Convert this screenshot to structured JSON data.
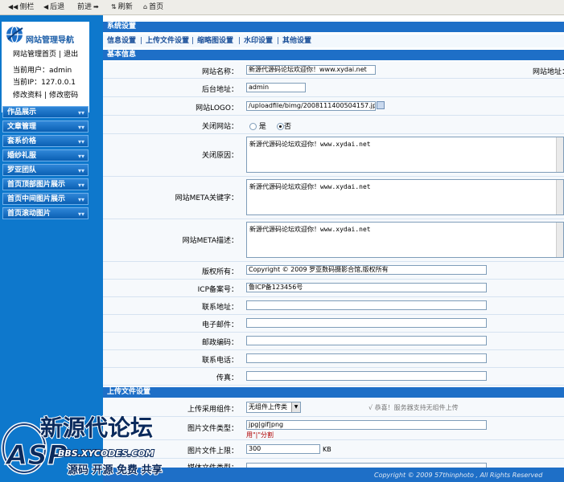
{
  "toolbar": {
    "sidebar_label": "侧栏",
    "back_label": "后退",
    "forward_label": "前进",
    "refresh_label": "刷新",
    "home_label": "首页"
  },
  "sidebar": {
    "logo_title": "网站管理导航",
    "link_home": "网站管理首页",
    "link_logout": "退出",
    "current_user_label": "当前用户：",
    "current_user": "admin",
    "current_ip_label": "当前IP：",
    "current_ip": "127.0.0.1",
    "link_edit_profile": "修改资料",
    "link_change_password": "修改密码",
    "menu": [
      "作品展示",
      "文章管理",
      "套系价格",
      "婚纱礼服",
      "罗亚团队",
      "首页顶部图片展示",
      "首页中间图片展示",
      "首页滚动图片"
    ]
  },
  "main": {
    "section_title": "系统设置",
    "tabs": [
      "信息设置",
      "上传文件设置",
      "缩略图设置",
      "水印设置",
      "其他设置"
    ],
    "basic_header": "基本信息",
    "site_name_label": "网站名称：",
    "site_name": "新源代源码论坛欢迎你！www.xydai.net",
    "site_url_label": "网站地址：",
    "admin_url_label": "后台地址：",
    "admin_url": "admin",
    "logo_label": "网站LOGO：",
    "logo_path": "/uploadfile/bimg/2008111400504157.jpg",
    "close_site_label": "关闭网站：",
    "radio_yes": "是",
    "radio_no": "否",
    "close_reason_label": "关闭原因：",
    "close_reason": "新源代源码论坛欢迎你！www.xydai.net",
    "meta_keywords_label": "网站META关键字：",
    "meta_keywords": "新源代源码论坛欢迎你！www.xydai.net",
    "meta_desc_label": "网站META描述：",
    "meta_desc": "新源代源码论坛欢迎你！www.xydai.net",
    "copyright_label": "版权所有：",
    "copyright": "Copyright © 2009 罗亚数码摄影合馆,版权所有",
    "icp_label": "ICP备案号：",
    "icp": "鲁ICP备123456号",
    "address_label": "联系地址：",
    "email_label": "电子邮件：",
    "zip_label": "邮政编码：",
    "phone_label": "联系电话：",
    "fax_label": "传真：",
    "upload_header": "上传文件设置",
    "upload_component_label": "上传采用组件：",
    "upload_component": "无组件上传类",
    "upload_hint": "√ 恭喜！服务器支持无组件上传",
    "image_types_label": "图片文件类型：",
    "image_types": "jpg|gif|png",
    "image_types_note": "用\"|\"分割",
    "image_size_label": "图片文件上限：",
    "image_size": "300",
    "image_size_unit": "KB",
    "other_type_label": "媒体文件类型："
  },
  "watermark": {
    "text_cn": "新源代论坛",
    "text_url": "BBS.XYCODES.COM",
    "slogan": "源码 开源 免费 共享",
    "logo_letters": "ASP"
  },
  "footer": {
    "copyright": "Copyright © 2009 57thinphoto , All Rights Reserved"
  },
  "colors": {
    "sidebar_blue": "#0e78cc",
    "header_blue": "#1e6fc7",
    "menu_text": "#ffffff",
    "tab_text": "#1a4f99"
  }
}
